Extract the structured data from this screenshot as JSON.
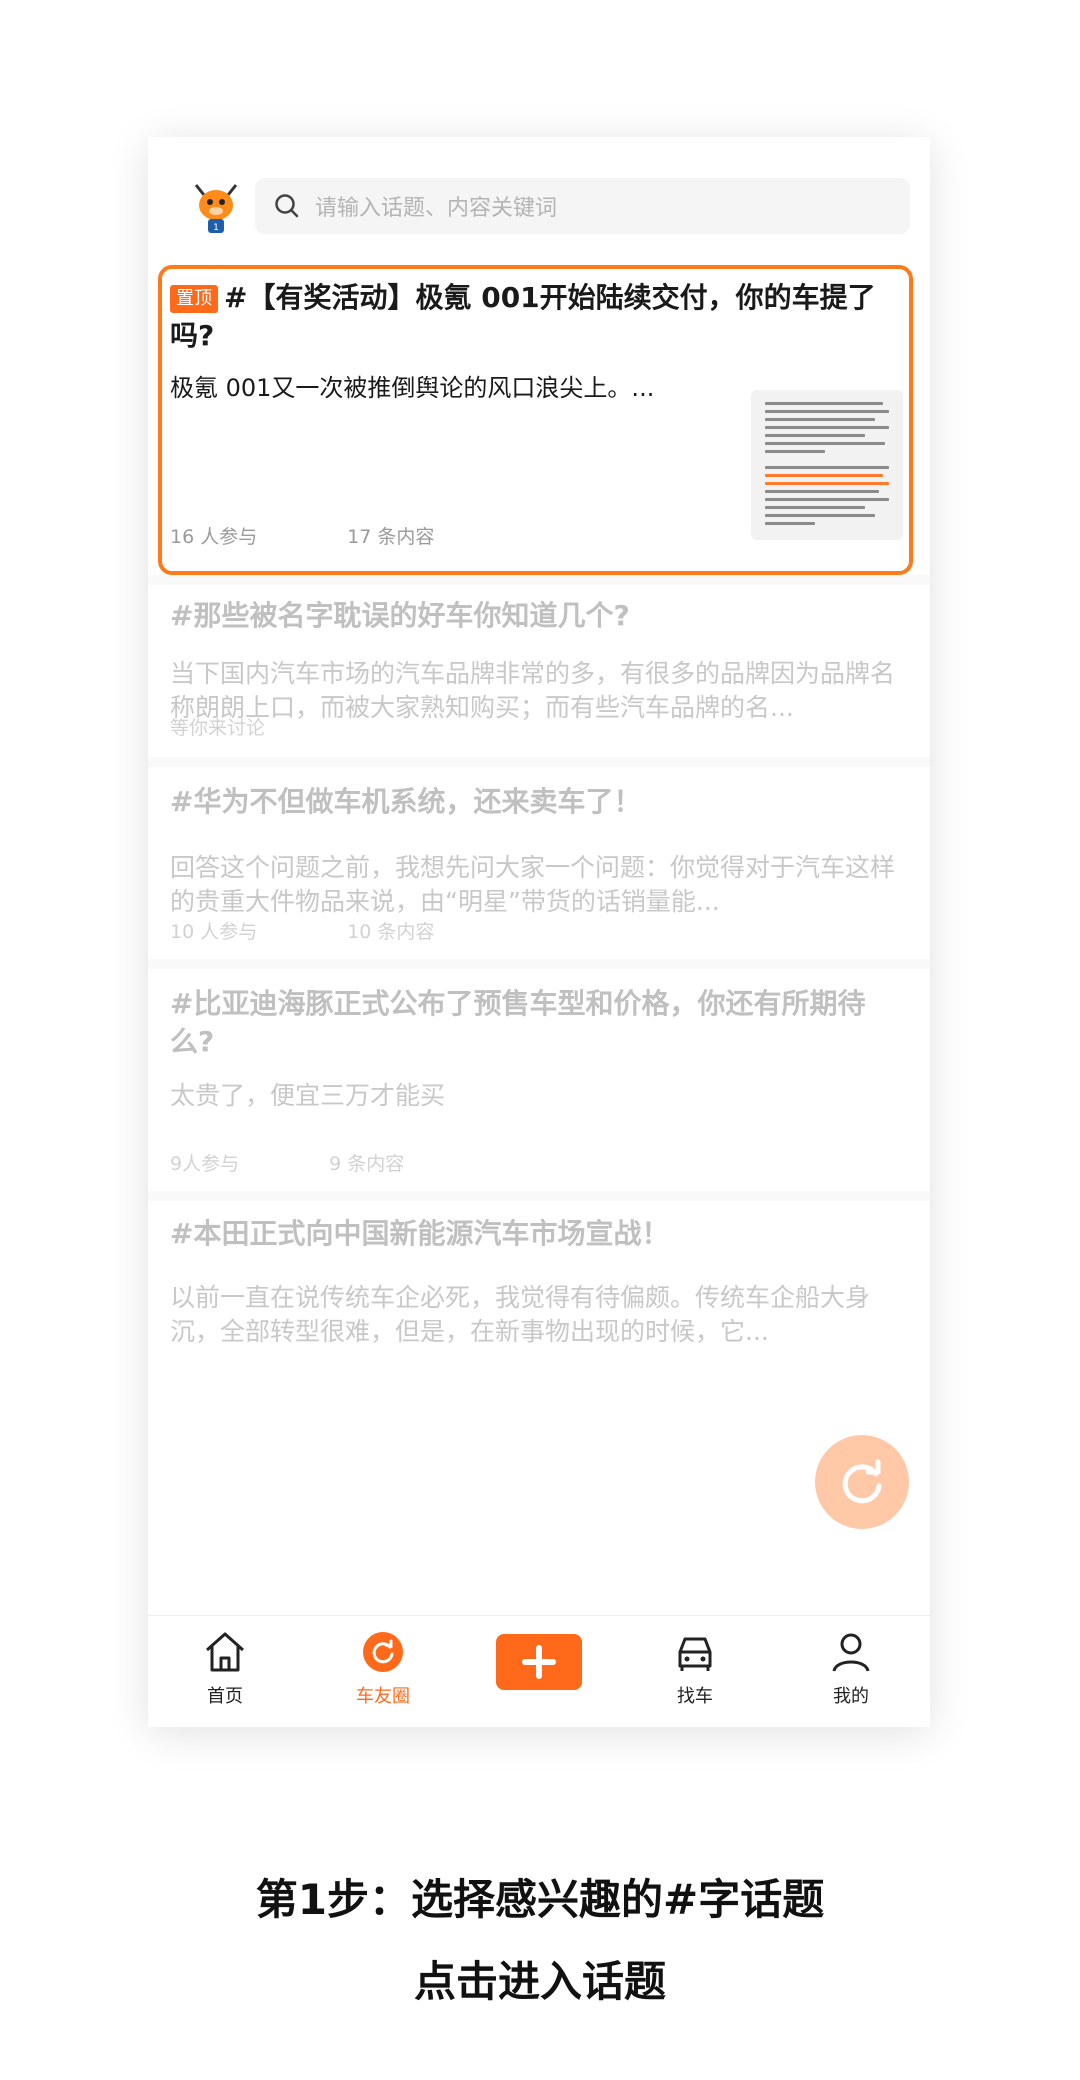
{
  "search": {
    "placeholder": "请输入话题、内容关键词"
  },
  "topics": [
    {
      "pin_label": "置顶",
      "title": "#【有奖活动】极氪 001开始陆续交付，你的车提了吗?",
      "excerpt": "极氪 001又一次被推倒舆论的风口浪尖上。...",
      "participants": "16 人参与",
      "contents": "17 条内容"
    },
    {
      "title": "#那些被名字耽误的好车你知道几个?",
      "excerpt": "当下国内汽车市场的汽车品牌非常的多，有很多的品牌因为品牌名称朗朗上口，而被大家熟知购买；而有些汽车品牌的名...",
      "status": "等你来讨论"
    },
    {
      "title": "#华为不但做车机系统，还来卖车了！",
      "excerpt": "回答这个问题之前，我想先问大家一个问题：你觉得对于汽车这样的贵重大件物品来说，由“明星”带货的话销量能...",
      "participants": "10 人参与",
      "contents": "10 条内容"
    },
    {
      "title": "#比亚迪海豚正式公布了预售车型和价格，你还有所期待么?",
      "excerpt": "太贵了，便宜三万才能买",
      "participants": "9人参与",
      "contents": "9 条内容"
    },
    {
      "title": "#本田正式向中国新能源汽车市场宣战！",
      "excerpt": "以前一直在说传统车企必死，我觉得有待偏颇。传统车企船大身沉，全部转型很难，但是，在新事物出现的时候，它..."
    }
  ],
  "tabbar": {
    "home": "首页",
    "circle": "车友圈",
    "find_car": "找车",
    "mine": "我的"
  },
  "caption": {
    "line1": "第1步：选择感兴趣的#字话题",
    "line2": "点击进入话题"
  },
  "colors": {
    "accent": "#ff6a1a",
    "fab": "#ffc9a8"
  },
  "icons": [
    "mascot-logo",
    "search-icon",
    "refresh-icon",
    "home-icon",
    "circle-icon",
    "plus-icon",
    "car-icon",
    "user-icon"
  ]
}
